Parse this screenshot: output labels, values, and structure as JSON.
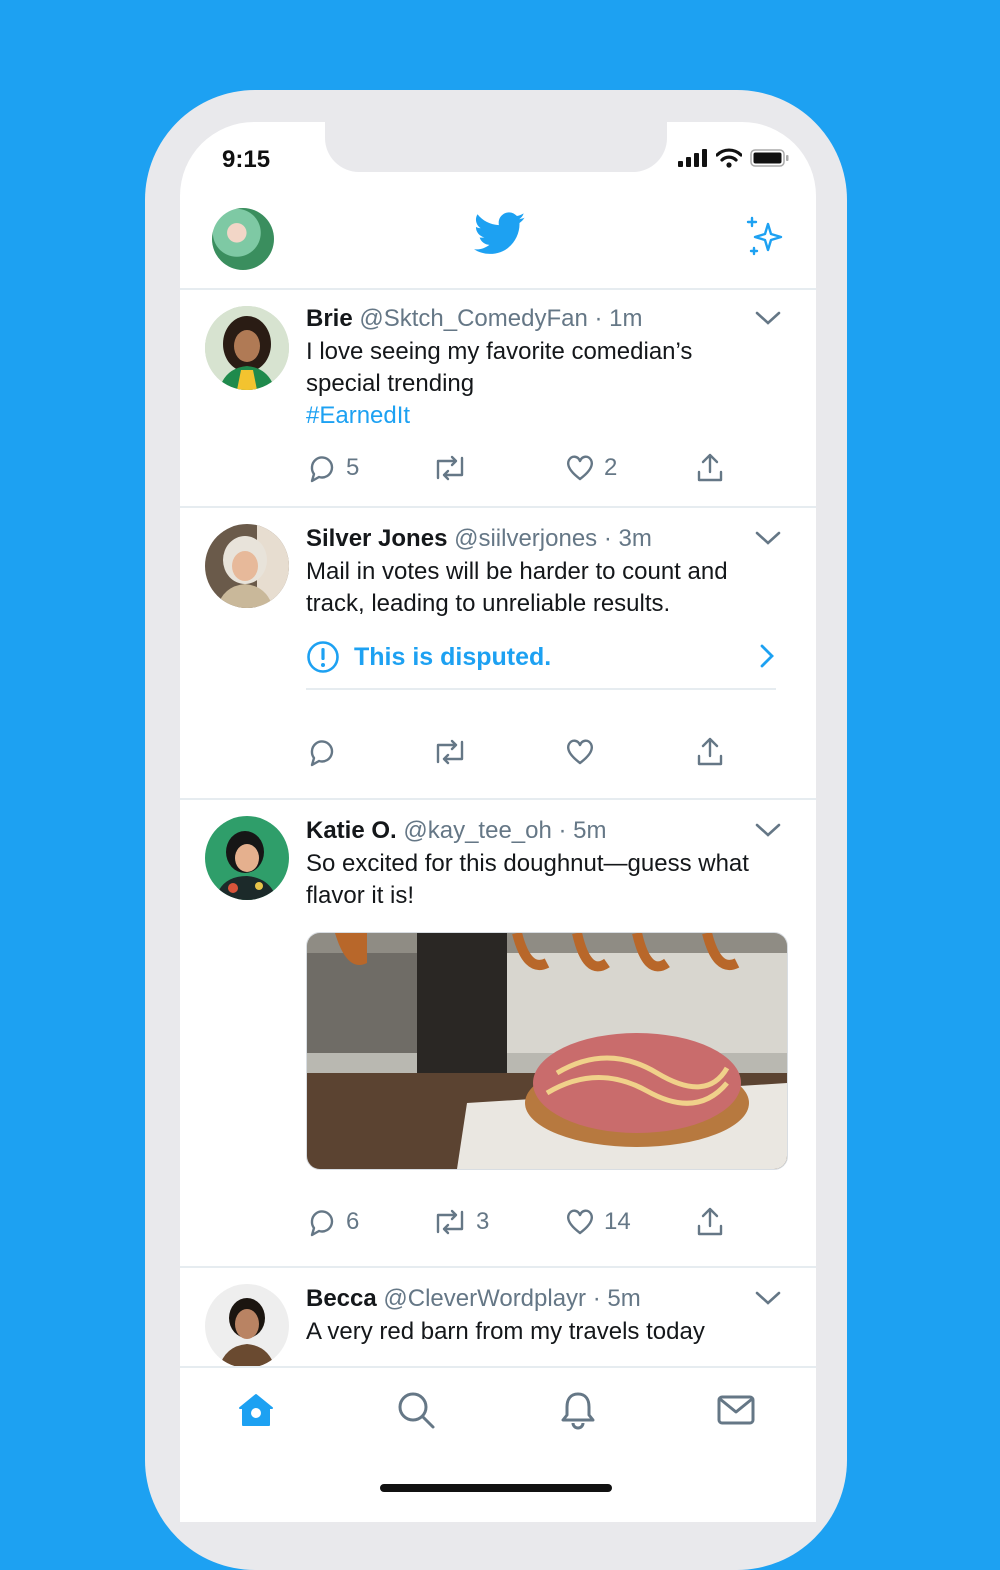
{
  "status_bar": {
    "time": "9:15"
  },
  "colors": {
    "brand": "#1da1f2",
    "text": "#14171a",
    "muted": "#657786"
  },
  "tweets": [
    {
      "name": "Brie",
      "handle": "@Sktch_ComedyFan",
      "time": "· 1m",
      "text": "I love seeing my favorite comedian’s special trending",
      "hashtag": "#EarnedIt",
      "replies": "5",
      "retweets": "",
      "likes": "2"
    },
    {
      "name": "Silver Jones",
      "handle": "@siilverjones",
      "time": "· 3m",
      "text": "Mail in votes will be harder to count and track, leading to unreliable results.",
      "label": "This is disputed.",
      "replies": "",
      "retweets": "",
      "likes": ""
    },
    {
      "name": "Katie O.",
      "handle": "@kay_tee_oh",
      "time": "· 5m",
      "text": "So excited for this doughnut—guess what flavor it is!",
      "replies": "6",
      "retweets": "3",
      "likes": "14"
    },
    {
      "name": "Becca",
      "handle": "@CleverWordplayr",
      "time": "· 5m",
      "text": "A very red barn from my travels today"
    }
  ],
  "icons": [
    "home-icon",
    "search-icon",
    "bell-icon",
    "mail-icon",
    "twitter-bird-icon",
    "sparkle-icon"
  ]
}
